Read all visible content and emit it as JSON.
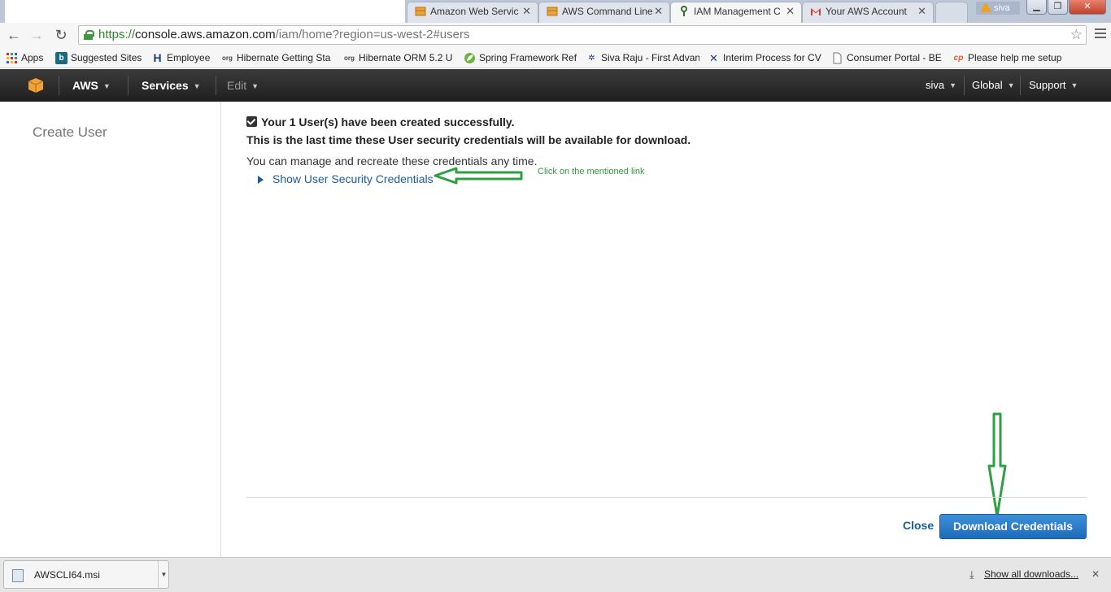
{
  "browser": {
    "tabs": [
      {
        "title": "Amazon Web Servic",
        "icon": "aws-box-icon"
      },
      {
        "title": "AWS Command Line",
        "icon": "aws-box-icon"
      },
      {
        "title": "IAM Management C",
        "icon": "iam-key-icon",
        "active": true
      },
      {
        "title": "Your AWS Account",
        "icon": "gmail-icon"
      }
    ],
    "profile_name": "siva",
    "url": {
      "scheme": "https://",
      "host": "console.aws.amazon.com",
      "path": "/iam/home?region=us-west-2#users"
    },
    "bookmarks": [
      {
        "label": "Apps",
        "icon": "apps-grid-icon"
      },
      {
        "label": "Suggested Sites",
        "icon": "bing-icon"
      },
      {
        "label": "Employee",
        "icon": "h-icon"
      },
      {
        "label": "Hibernate Getting Sta",
        "icon": "jboss-icon"
      },
      {
        "label": "Hibernate ORM 5.2 U",
        "icon": "jboss-icon"
      },
      {
        "label": "Spring Framework Ref",
        "icon": "spring-leaf-icon"
      },
      {
        "label": "Siva Raju - First Advan",
        "icon": "person-icon"
      },
      {
        "label": "Interim Process for CV",
        "icon": "x-tool-icon"
      },
      {
        "label": "Consumer Portal - BE",
        "icon": "page-icon"
      },
      {
        "label": "Please help me setup",
        "icon": "cp-icon"
      }
    ]
  },
  "awsnav": {
    "brand": "AWS",
    "services": "Services",
    "edit": "Edit",
    "user": "siva",
    "region": "Global",
    "support": "Support"
  },
  "page": {
    "title": "Create User",
    "success_message": "Your 1 User(s) have been created successfully.",
    "last_time_message": "This is the last time these User security credentials will be available for download.",
    "manage_message": "You can manage and recreate these credentials any time.",
    "show_credentials_link": "Show User Security Credentials",
    "annotation_hint": "Click on the mentioned link",
    "close_label": "Close",
    "download_label": "Download Credentials"
  },
  "download_shelf": {
    "file_name": "AWSCLI64.msi",
    "show_all": "Show all downloads..."
  },
  "colors": {
    "aws_nav_bg": "#232323",
    "link_blue": "#1c5c9e",
    "primary_button": "#1f6bbd",
    "annotation_green": "#2e9a3a"
  }
}
